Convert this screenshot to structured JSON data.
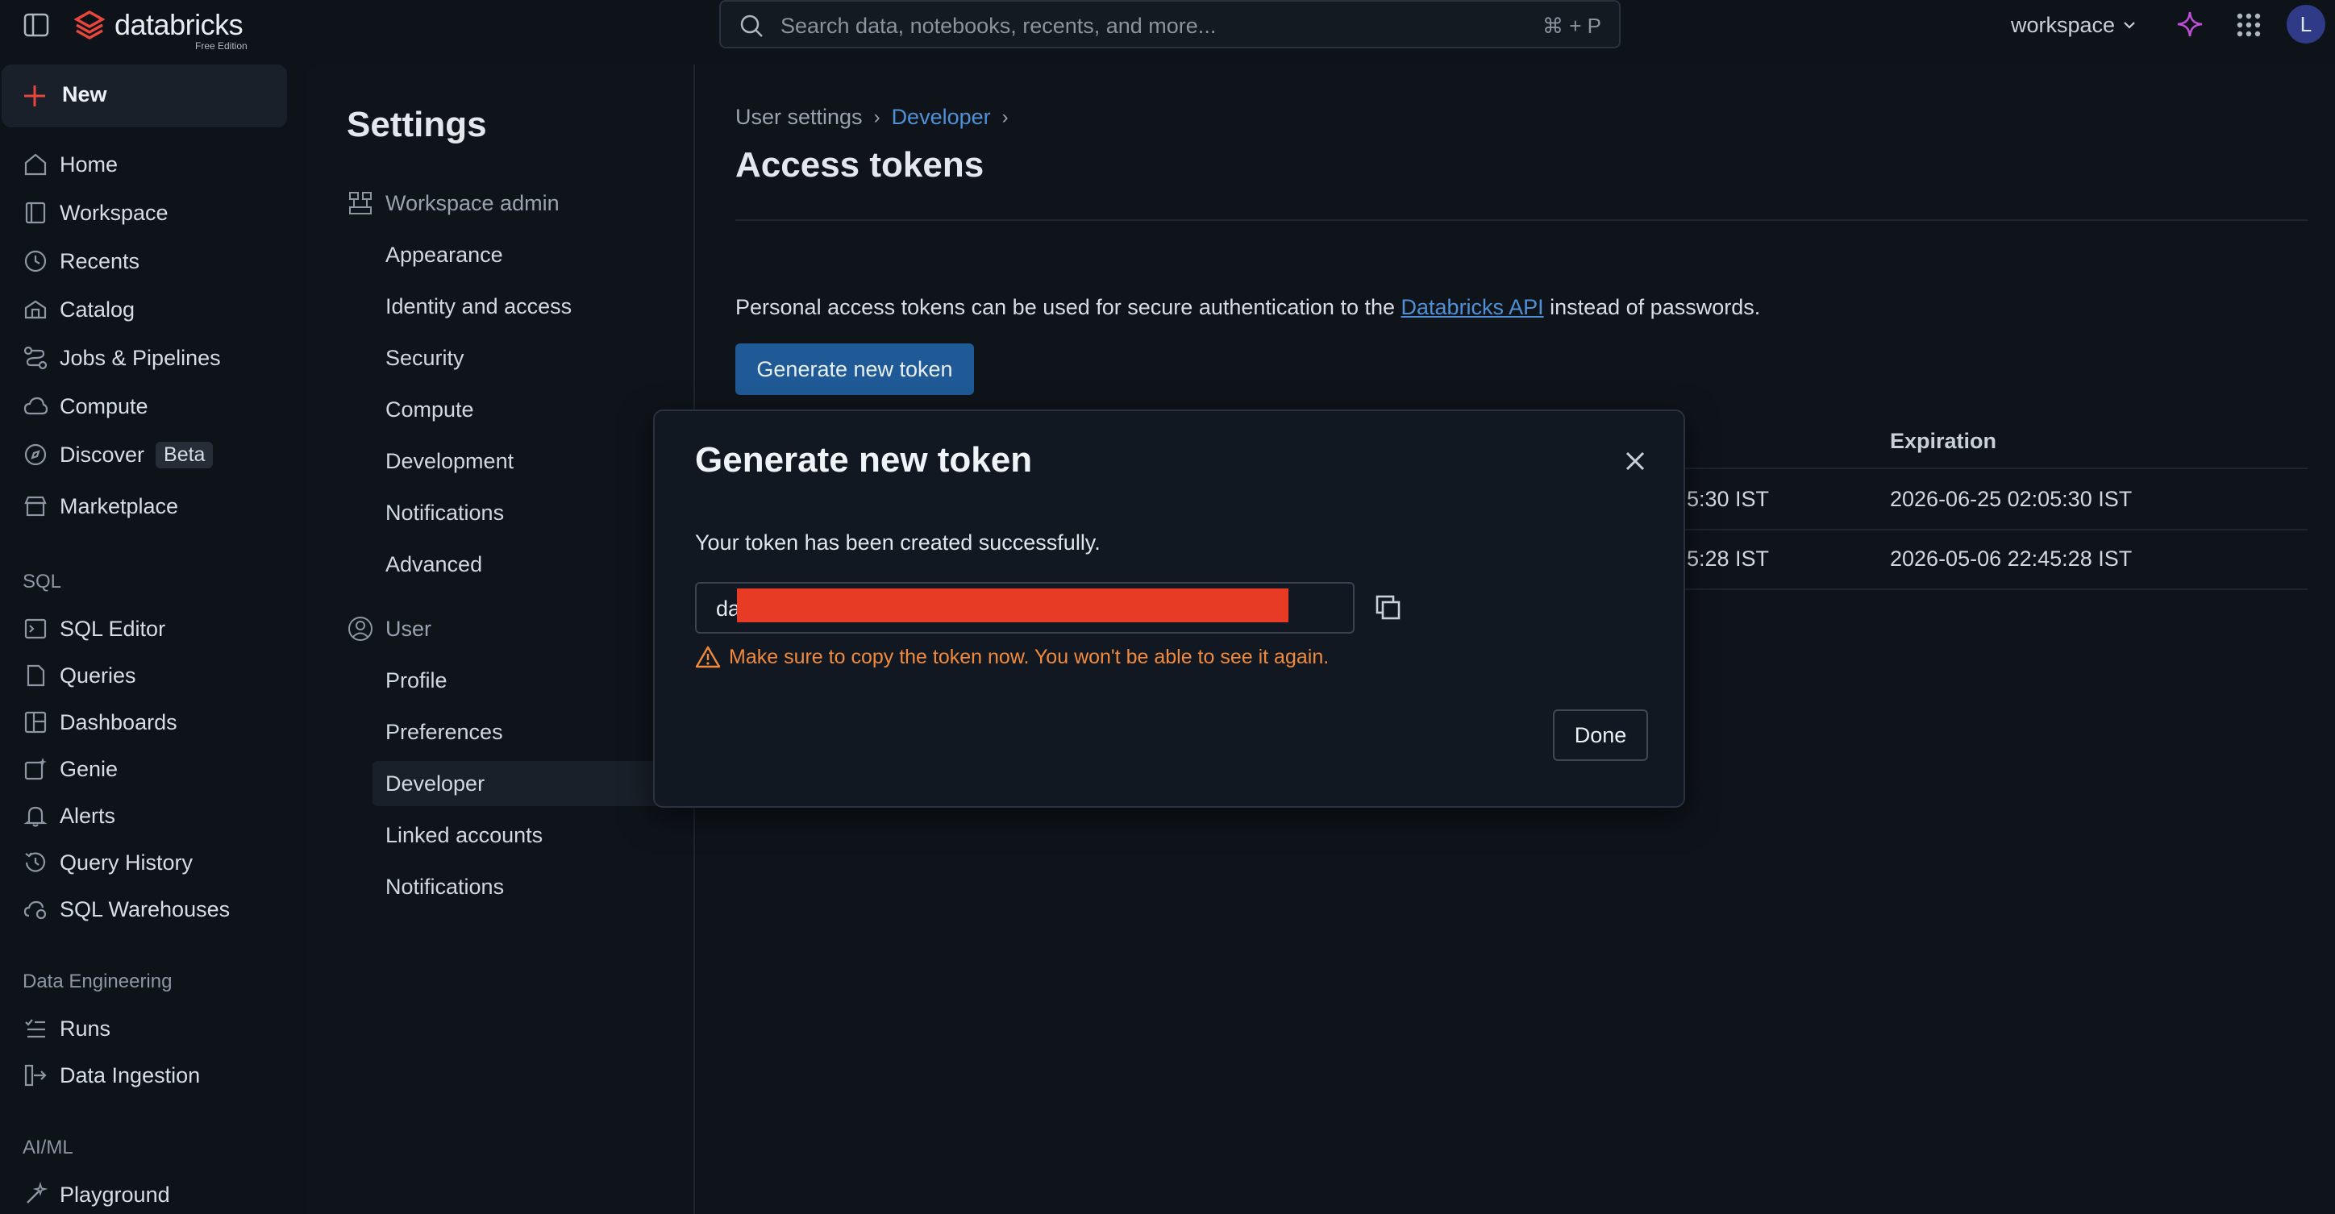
{
  "topbar": {
    "logo_name": "databricks",
    "logo_edition": "Free Edition",
    "search_placeholder": "Search data, notebooks, recents, and more...",
    "search_shortcut": "⌘ + P",
    "workspace_label": "workspace",
    "avatar_initial": "L"
  },
  "leftnav": {
    "new_label": "New",
    "items": [
      {
        "label": "Home",
        "icon": "home-icon"
      },
      {
        "label": "Workspace",
        "icon": "workspace-icon"
      },
      {
        "label": "Recents",
        "icon": "clock-icon"
      },
      {
        "label": "Catalog",
        "icon": "catalog-icon"
      },
      {
        "label": "Jobs & Pipelines",
        "icon": "pipelines-icon"
      },
      {
        "label": "Compute",
        "icon": "cloud-icon"
      },
      {
        "label": "Discover",
        "icon": "compass-icon",
        "badge": "Beta"
      },
      {
        "label": "Marketplace",
        "icon": "store-icon"
      }
    ],
    "sql_section": "SQL",
    "sql_items": [
      {
        "label": "SQL Editor",
        "icon": "sql-editor-icon"
      },
      {
        "label": "Queries",
        "icon": "query-icon"
      },
      {
        "label": "Dashboards",
        "icon": "dashboard-icon"
      },
      {
        "label": "Genie",
        "icon": "genie-icon"
      },
      {
        "label": "Alerts",
        "icon": "bell-icon"
      },
      {
        "label": "Query History",
        "icon": "history-icon"
      },
      {
        "label": "SQL Warehouses",
        "icon": "warehouse-icon"
      }
    ],
    "de_section": "Data Engineering",
    "de_items": [
      {
        "label": "Runs",
        "icon": "runs-icon"
      },
      {
        "label": "Data Ingestion",
        "icon": "ingestion-icon"
      }
    ],
    "ai_section": "AI/ML",
    "ai_items": [
      {
        "label": "Playground",
        "icon": "playground-icon"
      }
    ]
  },
  "settings": {
    "title": "Settings",
    "workspace_admin_label": "Workspace admin",
    "admin_items": [
      "Appearance",
      "Identity and access",
      "Security",
      "Compute",
      "Development",
      "Notifications",
      "Advanced"
    ],
    "user_label": "User",
    "user_items": [
      "Profile",
      "Preferences",
      "Developer",
      "Linked accounts",
      "Notifications"
    ],
    "active_item": "Developer"
  },
  "content": {
    "breadcrumb": [
      "User settings",
      "Developer"
    ],
    "title": "Access tokens",
    "desc_before": "Personal access tokens can be used for secure authentication to the ",
    "desc_link": "Databricks API",
    "desc_after": " instead of passwords.",
    "generate_button": "Generate new token",
    "table": {
      "expiration_header": "Expiration",
      "rows": [
        {
          "created_partial": "5:30 IST",
          "expiration": "2026-06-25 02:05:30 IST"
        },
        {
          "created_partial": "5:28 IST",
          "expiration": "2026-05-06 22:45:28 IST"
        }
      ]
    }
  },
  "modal": {
    "title": "Generate new token",
    "message": "Your token has been created successfully.",
    "token_prefix": "da",
    "warning": "Make sure to copy the token now. You won't be able to see it again.",
    "done_label": "Done"
  },
  "colors": {
    "accent": "#1f5a96",
    "link": "#4f90d6",
    "warning": "#f18a3b",
    "redaction": "#e83b26",
    "brand": "#e8453c"
  }
}
